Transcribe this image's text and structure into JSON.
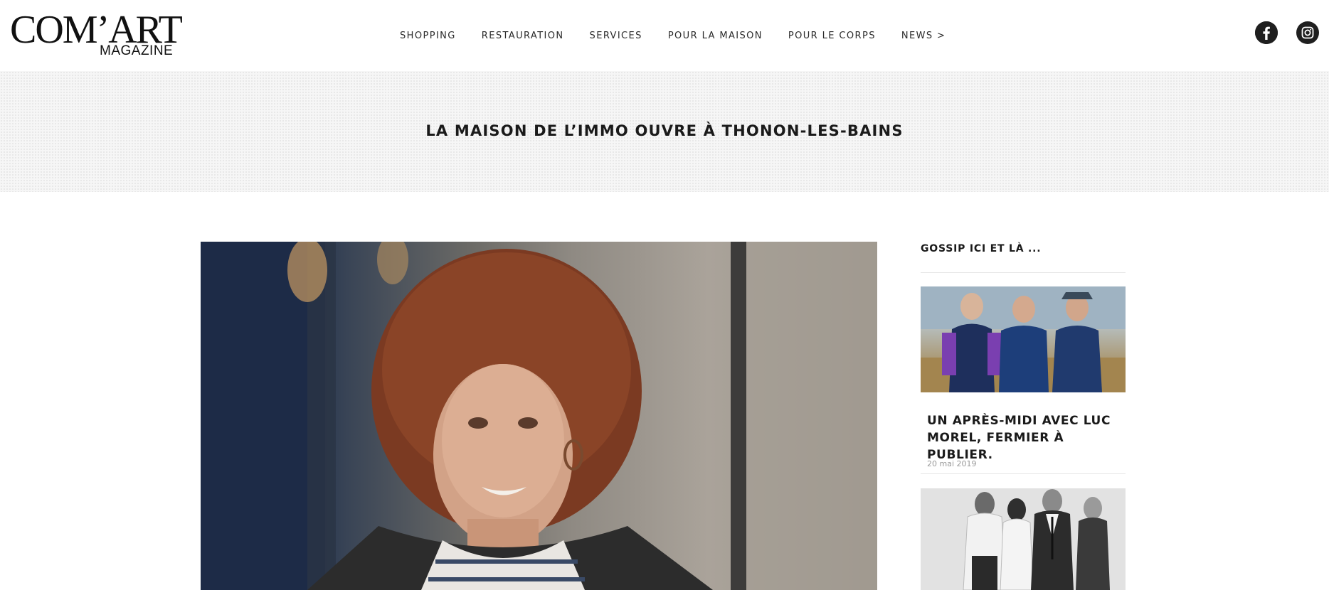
{
  "brand": {
    "logo_main": "COM’ART",
    "logo_sub": "MAGAZINE"
  },
  "nav": {
    "items": [
      {
        "label": "SHOPPING"
      },
      {
        "label": "RESTAURATION"
      },
      {
        "label": "SERVICES"
      },
      {
        "label": "POUR LA MAISON"
      },
      {
        "label": "POUR LE CORPS"
      },
      {
        "label": "NEWS >"
      }
    ]
  },
  "social": {
    "icons": [
      "facebook-icon",
      "instagram-icon"
    ]
  },
  "article": {
    "title": "LA MAISON DE L’IMMO OUVRE À THONON-LES-BAINS"
  },
  "sidebar": {
    "title": "GOSSIP ICI ET LÀ ...",
    "posts": [
      {
        "headline": "UN APRÈS-MIDI AVEC LUC MOREL, FERMIER À PUBLIER.",
        "date": "20 mai 2019"
      }
    ]
  },
  "colors": {
    "text": "#1a1a1a",
    "band": "#f6f6f6",
    "muted": "#9a9a9a"
  }
}
